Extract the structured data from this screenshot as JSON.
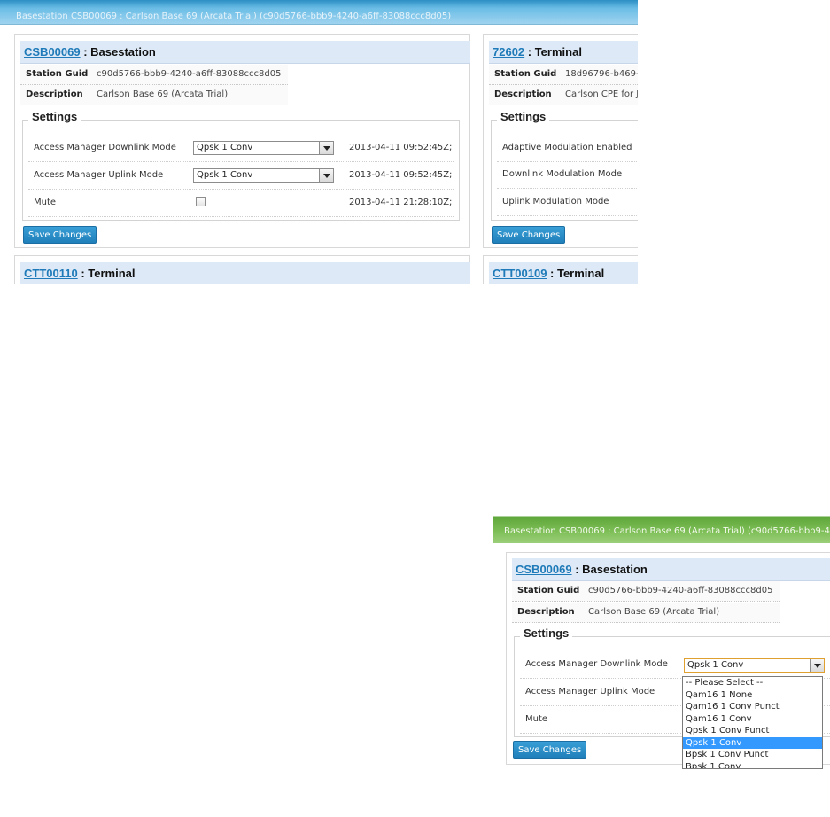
{
  "window_title": "Basestation CSB00069 : Carlson Base 69 (Arcata Trial) (c90d5766-bbb9-4240-a6ff-83088ccc8d05)",
  "window_title_cropped": "Basestation CSB00069 : Carlson Base 69 (Arcata Trial) (c90d5766-bbb9-42",
  "basestation": {
    "link": "CSB00069",
    "type": " : Basestation",
    "guid_label": "Station Guid",
    "guid": "c90d5766-bbb9-4240-a6ff-83088ccc8d05",
    "desc_label": "Description",
    "desc": "Carlson Base 69 (Arcata Trial)",
    "settings_legend": "Settings",
    "settings": [
      {
        "label": "Access Manager Downlink Mode",
        "value": "Qpsk 1 Conv",
        "ts": "2013-04-11 09:52:45Z;"
      },
      {
        "label": "Access Manager Uplink Mode",
        "value": "Qpsk 1 Conv",
        "ts": "2013-04-11 09:52:45Z;"
      },
      {
        "label": "Mute",
        "checked": false,
        "ts": "2013-04-11 21:28:10Z;"
      }
    ],
    "save_label": "Save Changes"
  },
  "terminal_72602": {
    "link": "72602",
    "type": " : Terminal",
    "guid_label": "Station Guid",
    "guid": "18d96796-b469-",
    "desc_label": "Description",
    "desc": "Carlson CPE for J",
    "settings_legend": "Settings",
    "settings": [
      {
        "label": "Adaptive Modulation Enabled"
      },
      {
        "label": "Downlink Modulation Mode"
      },
      {
        "label": "Uplink Modulation Mode"
      }
    ],
    "save_label": "Save Changes"
  },
  "terminal_ctt00110": {
    "link": "CTT00110",
    "type": " : Terminal"
  },
  "terminal_ctt00109": {
    "link": "CTT00109",
    "type": " : Terminal"
  },
  "dropdown_options": [
    "-- Please Select --",
    "Qam16 1 None",
    "Qam16 1 Conv Punct",
    "Qam16 1 Conv",
    "Qpsk 1 Conv Punct",
    "Qpsk 1 Conv",
    "Bpsk 1 Conv Punct",
    "Bpsk 1 Conv"
  ],
  "dropdown_selected": "Qpsk 1 Conv",
  "colors": {
    "header_blue": "#4aa7dc",
    "header_green": "#74b84c",
    "link": "#1e7ab8",
    "button": "#2386c6",
    "panel_head": "#dde9f6"
  }
}
